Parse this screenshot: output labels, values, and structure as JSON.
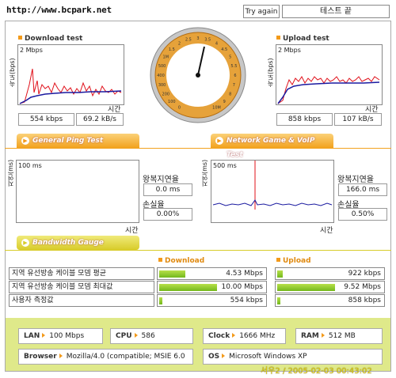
{
  "url": "http://www.bcpark.net",
  "watermark": "서우2 / 2005-02-03 00:43:02",
  "toolbar": {
    "try_again": "Try again",
    "status": "테스트 끝"
  },
  "download": {
    "title": "Download test",
    "yaxis": "속도(bps)",
    "scale": "2 Mbps",
    "xaxis": "시간",
    "kbps": "554 kbps",
    "kBs": "69.2 kB/s"
  },
  "upload": {
    "title": "Upload test",
    "yaxis": "속도(bps)",
    "scale": "2 Mbps",
    "xaxis": "시간",
    "kbps": "858 kbps",
    "kBs": "107 kB/s"
  },
  "gauge": {
    "ticks": [
      "0",
      "100",
      "200",
      "300",
      "400",
      "500",
      "1M",
      "1.5",
      "2",
      "2.5",
      "3",
      "3.5",
      "4",
      "4.5",
      "5",
      "5.5",
      "6",
      "7",
      "8",
      "9",
      "10M"
    ],
    "needle_value": "0.554 Mbps"
  },
  "tabs": {
    "ping": "General Ping Test",
    "game": "Network Game & VoIP Test",
    "bandwidth": "Bandwidth Gauge"
  },
  "ping": {
    "yaxis": "지연(ms)",
    "scale": "100 ms",
    "xaxis": "시간",
    "rtt_label": "왕복지연율",
    "rtt": "0.0 ms",
    "loss_label": "손실율",
    "loss": "0.00%"
  },
  "game": {
    "yaxis": "지연(ms)",
    "scale": "500 ms",
    "xaxis": "시간",
    "rtt_label": "왕복지연율",
    "rtt": "166.0 ms",
    "loss_label": "손실율",
    "loss": "0.50%"
  },
  "bandwidth": {
    "download_header": "Download",
    "upload_header": "Upload",
    "rows": [
      {
        "label": "지역 유선방송 케이블 모뎀 평균",
        "down": "4.53 Mbps",
        "down_level": 0.25,
        "up": "922 kbps",
        "up_level": 0.05
      },
      {
        "label": "지역 유선방송 케이블 모뎀 최대값",
        "down": "10.00 Mbps",
        "down_level": 0.55,
        "up": "9.52 Mbps",
        "up_level": 0.55
      },
      {
        "label": "사용자 측정값",
        "down": "554 kbps",
        "down_level": 0.03,
        "up": "858 kbps",
        "up_level": 0.03
      }
    ]
  },
  "system": {
    "lan_label": "LAN",
    "lan": "100 Mbps",
    "cpu_label": "CPU",
    "cpu": "586",
    "clock_label": "Clock",
    "clock": "1666 MHz",
    "ram_label": "RAM",
    "ram": "512 MB",
    "browser_label": "Browser",
    "browser": "Mozilla/4.0 (compatible; MSIE 6.0",
    "os_label": "OS",
    "os": "Microsoft Windows XP"
  },
  "colors": {
    "accent": "#f39a1a",
    "series_red": "#e0101a",
    "series_blue": "#1a1aa0",
    "bar_green": "#72b81c",
    "footer_bg": "#dfe98a"
  }
}
